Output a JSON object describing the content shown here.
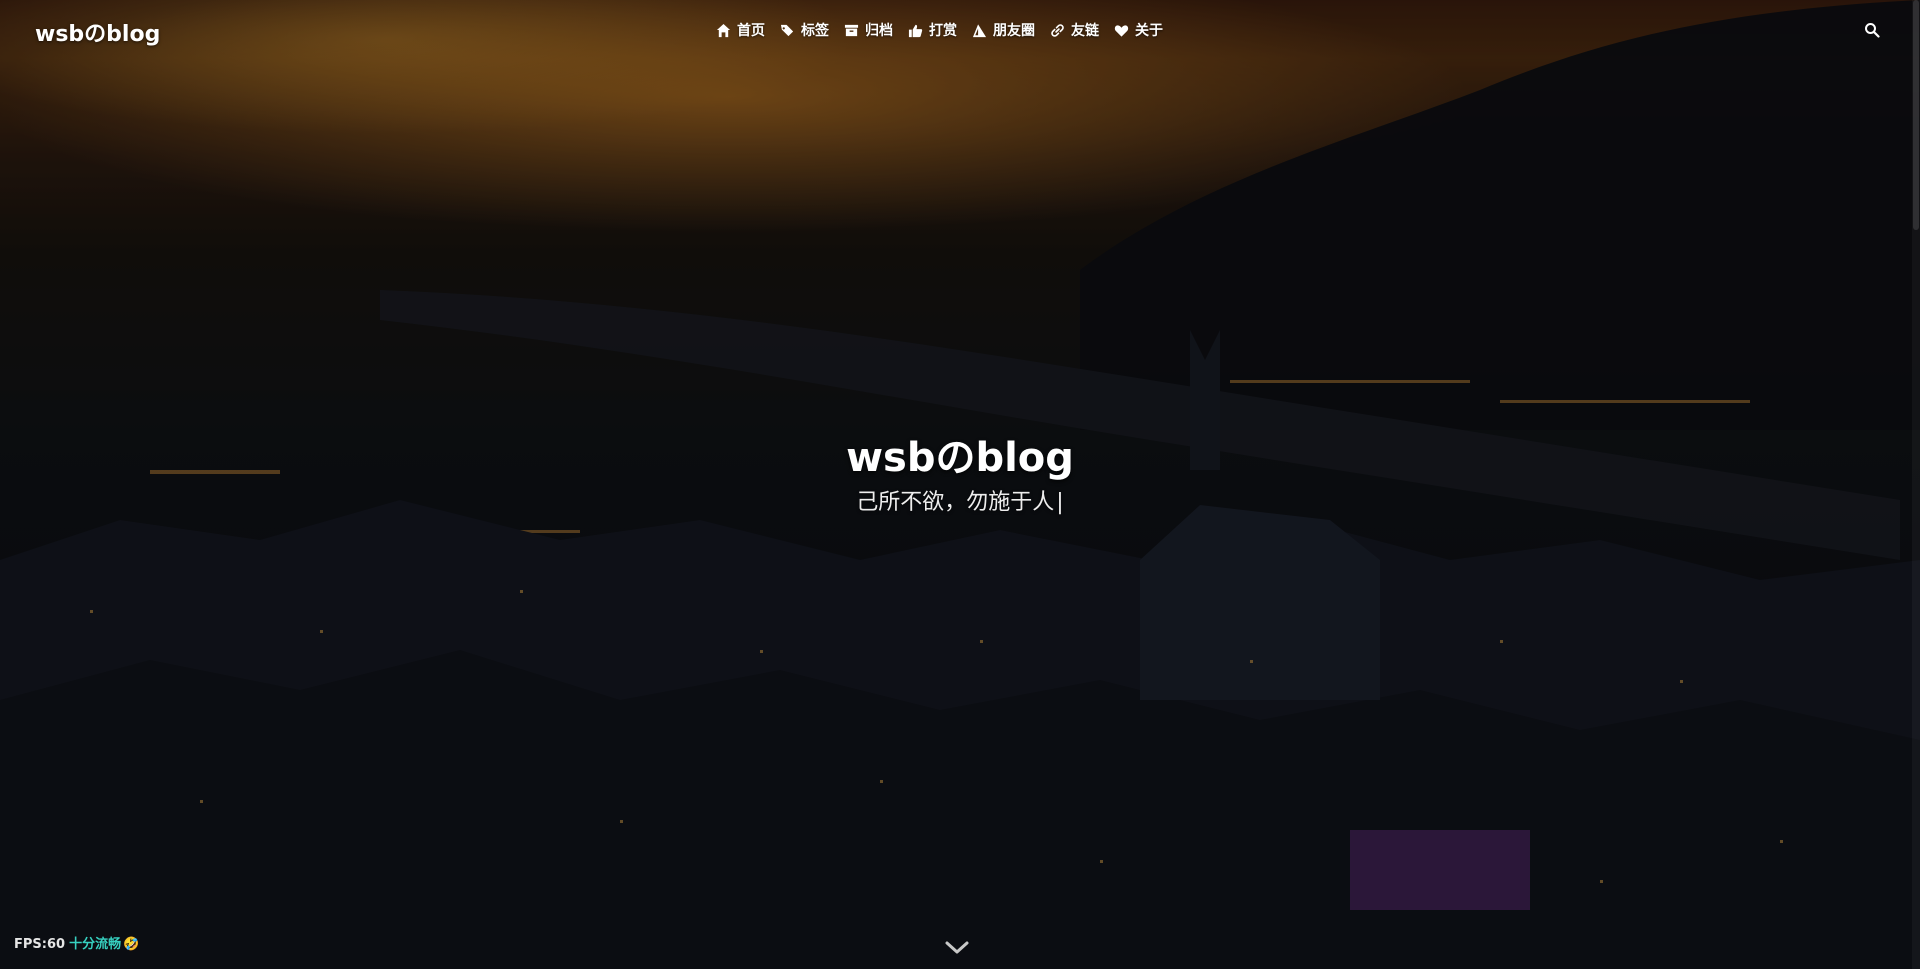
{
  "site": {
    "logo": "wsbのblog"
  },
  "nav": {
    "items": [
      {
        "label": "首页",
        "icon": "home-icon"
      },
      {
        "label": "标签",
        "icon": "tags-icon"
      },
      {
        "label": "归档",
        "icon": "archive-icon"
      },
      {
        "label": "打赏",
        "icon": "thumbs-up-icon"
      },
      {
        "label": "朋友圈",
        "icon": "triangle-icon"
      },
      {
        "label": "友链",
        "icon": "link-icon"
      },
      {
        "label": "关于",
        "icon": "heart-icon"
      }
    ],
    "search_icon": "search-icon"
  },
  "hero": {
    "title": "wsbのblog",
    "subtitle": "己所不欲，勿施于人",
    "cursor": "|"
  },
  "status": {
    "fps_label": "FPS:60",
    "smooth_text": "十分流畅",
    "emoji": "🤣"
  },
  "colors": {
    "accent_teal": "#37d0c0",
    "text": "#ffffff"
  }
}
